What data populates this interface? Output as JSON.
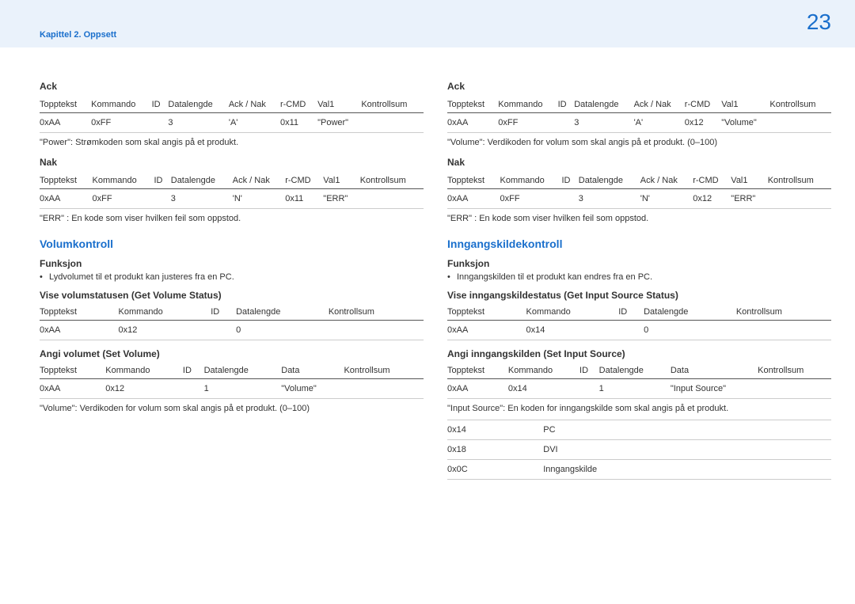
{
  "header": {
    "chapter": "Kapittel 2. Oppsett",
    "page": "23"
  },
  "left": {
    "ack": {
      "title": "Ack",
      "headers": [
        "Topptekst",
        "Kommando",
        "ID",
        "Datalengde",
        "Ack / Nak",
        "r-CMD",
        "Val1",
        "Kontrollsum"
      ],
      "row": [
        "0xAA",
        "0xFF",
        "",
        "3",
        "'A'",
        "0x11",
        "\"Power\"",
        ""
      ],
      "note": "\"Power\": Strømkoden som skal angis på et produkt."
    },
    "nak": {
      "title": "Nak",
      "headers": [
        "Topptekst",
        "Kommando",
        "ID",
        "Datalengde",
        "Ack / Nak",
        "r-CMD",
        "Val1",
        "Kontrollsum"
      ],
      "row": [
        "0xAA",
        "0xFF",
        "",
        "3",
        "'N'",
        "0x11",
        "\"ERR\"",
        ""
      ],
      "note": "\"ERR\" : En kode som viser hvilken feil som oppstod."
    },
    "section": {
      "title": "Volumkontroll",
      "funcLabel": "Funksjon",
      "funcText": "Lydvolumet til et produkt kan justeres fra en PC.",
      "get": {
        "title": "Vise volumstatusen (Get Volume Status)",
        "headers": [
          "Topptekst",
          "Kommando",
          "ID",
          "Datalengde",
          "Kontrollsum"
        ],
        "row": [
          "0xAA",
          "0x12",
          "",
          "0",
          ""
        ]
      },
      "set": {
        "title": "Angi volumet (Set Volume)",
        "headers": [
          "Topptekst",
          "Kommando",
          "ID",
          "Datalengde",
          "Data",
          "Kontrollsum"
        ],
        "row": [
          "0xAA",
          "0x12",
          "",
          "1",
          "\"Volume\"",
          ""
        ],
        "note": "\"Volume\": Verdikoden for volum som skal angis på et produkt. (0–100)"
      }
    }
  },
  "right": {
    "ack": {
      "title": "Ack",
      "headers": [
        "Topptekst",
        "Kommando",
        "ID",
        "Datalengde",
        "Ack / Nak",
        "r-CMD",
        "Val1",
        "Kontrollsum"
      ],
      "row": [
        "0xAA",
        "0xFF",
        "",
        "3",
        "'A'",
        "0x12",
        "\"Volume\"",
        ""
      ],
      "note": "\"Volume\": Verdikoden for volum som skal angis på et produkt. (0–100)"
    },
    "nak": {
      "title": "Nak",
      "headers": [
        "Topptekst",
        "Kommando",
        "ID",
        "Datalengde",
        "Ack / Nak",
        "r-CMD",
        "Val1",
        "Kontrollsum"
      ],
      "row": [
        "0xAA",
        "0xFF",
        "",
        "3",
        "'N'",
        "0x12",
        "\"ERR\"",
        ""
      ],
      "note": "\"ERR\" : En kode som viser hvilken feil som oppstod."
    },
    "section": {
      "title": "Inngangskildekontroll",
      "funcLabel": "Funksjon",
      "funcText": "Inngangskilden til et produkt kan endres fra en PC.",
      "get": {
        "title": "Vise inngangskildestatus (Get Input Source Status)",
        "headers": [
          "Topptekst",
          "Kommando",
          "ID",
          "Datalengde",
          "Kontrollsum"
        ],
        "row": [
          "0xAA",
          "0x14",
          "",
          "0",
          ""
        ]
      },
      "set": {
        "title": "Angi inngangskilden (Set Input Source)",
        "headers": [
          "Topptekst",
          "Kommando",
          "ID",
          "Datalengde",
          "Data",
          "Kontrollsum"
        ],
        "row": [
          "0xAA",
          "0x14",
          "",
          "1",
          "\"Input Source\"",
          ""
        ],
        "note": "\"Input Source\": En koden for inngangskilde som skal angis på et produkt."
      },
      "codes": [
        {
          "code": "0x14",
          "name": "PC"
        },
        {
          "code": "0x18",
          "name": "DVI"
        },
        {
          "code": "0x0C",
          "name": "Inngangskilde"
        }
      ]
    }
  }
}
